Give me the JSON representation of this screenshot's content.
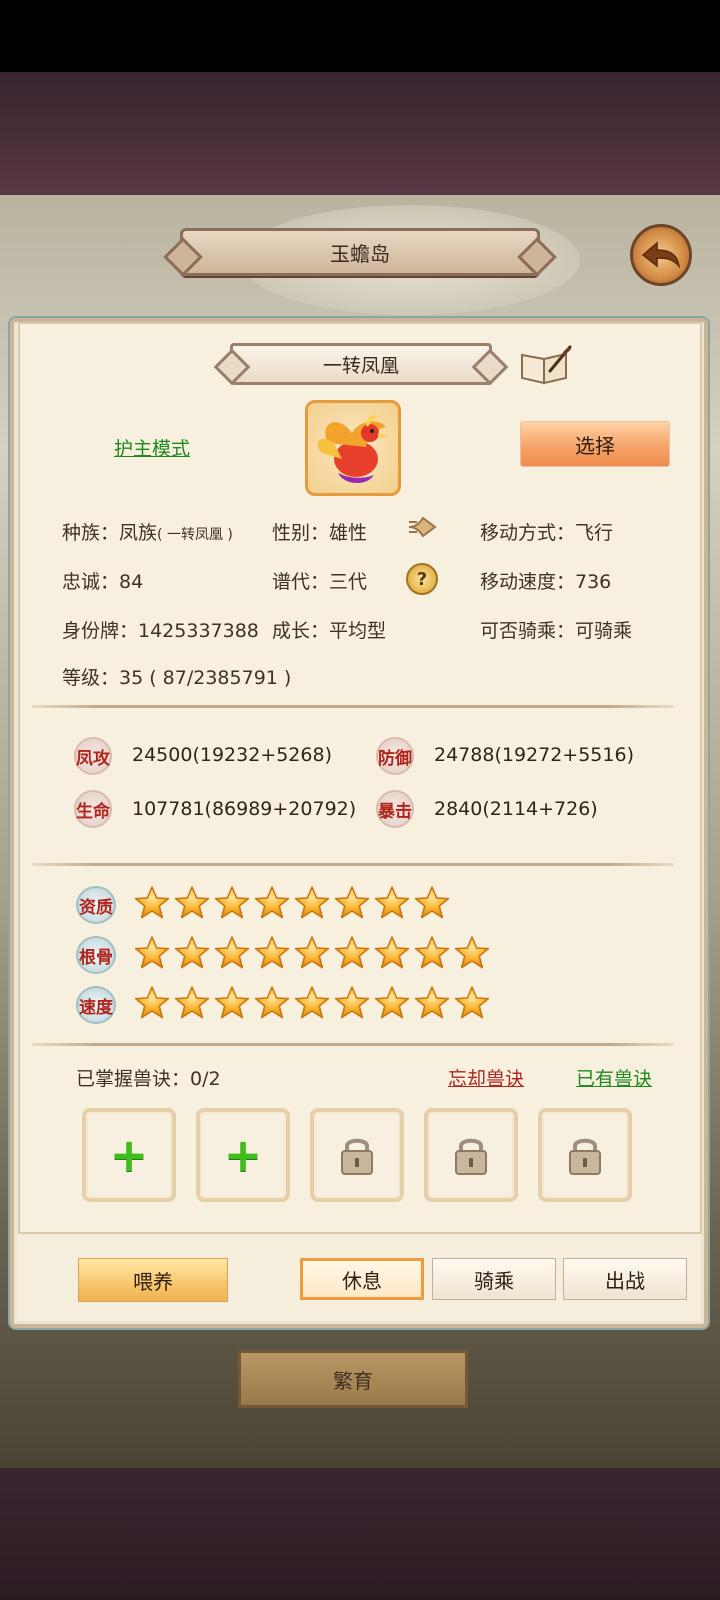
{
  "header": {
    "location": "玉蟾岛"
  },
  "pet": {
    "name": "一转凤凰",
    "guard_mode_label": "护主模式",
    "select_label": "选择"
  },
  "info": {
    "race_label": "种族：",
    "race_value": "凤族",
    "race_sub": "( 一转凤凰 )",
    "gender": "性别：雄性",
    "move_type": "移动方式：飞行",
    "loyalty": "忠诚：84",
    "generation": "谱代：三代",
    "move_speed": "移动速度：736",
    "id_tag": "身份牌：1425337388",
    "growth": "成长：平均型",
    "rideable": "可否骑乘：可骑乘",
    "level": "等级：35 ( 87/2385791 )"
  },
  "attributes": [
    {
      "badge": "凤攻",
      "value": "24500(19232+5268)"
    },
    {
      "badge": "防御",
      "value": "24788(19272+5516)"
    },
    {
      "badge": "生命",
      "value": "107781(86989+20792)"
    },
    {
      "badge": "暴击",
      "value": "2840(2114+726)"
    }
  ],
  "qualities": [
    {
      "label": "资质",
      "stars": 8
    },
    {
      "label": "根骨",
      "stars": 9
    },
    {
      "label": "速度",
      "stars": 9
    }
  ],
  "skills": {
    "mastered": "已掌握兽诀：0/2",
    "forget_label": "忘却兽诀",
    "owned_label": "已有兽诀",
    "slots": [
      "add",
      "add",
      "locked",
      "locked",
      "locked"
    ]
  },
  "actions": {
    "feed": "喂养",
    "rest": "休息",
    "ride": "骑乘",
    "battle": "出战",
    "breed": "繁育"
  },
  "colors": {
    "accent": "#f09a3d",
    "link_green": "#1f8a1f",
    "link_red": "#b0261e"
  }
}
